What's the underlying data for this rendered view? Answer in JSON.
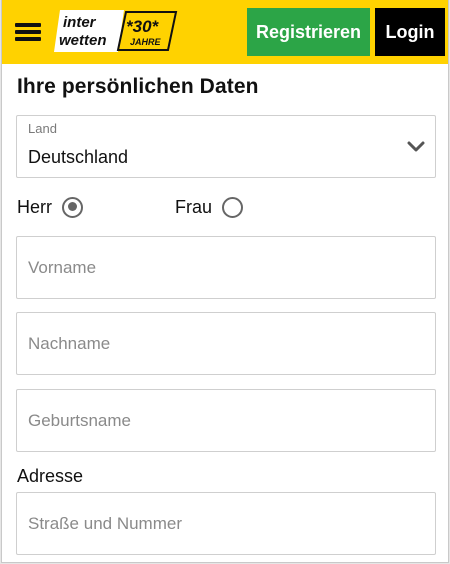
{
  "header": {
    "logo_line1": "inter",
    "logo_line2": "wetten",
    "logo_badge": "*30*",
    "logo_badge_sub": "JAHRE",
    "register_label": "Registrieren",
    "login_label": "Login",
    "colors": {
      "bar": "#ffd200",
      "register": "#2ca547",
      "login": "#000000"
    }
  },
  "form": {
    "title": "Ihre persönlichen Daten",
    "country": {
      "label": "Land",
      "value": "Deutschland"
    },
    "salutation": [
      {
        "label": "Herr",
        "selected": true
      },
      {
        "label": "Frau",
        "selected": false
      }
    ],
    "first_name": {
      "placeholder": "Vorname"
    },
    "last_name": {
      "placeholder": "Nachname"
    },
    "birth_name": {
      "placeholder": "Geburtsname"
    },
    "address_label": "Adresse",
    "street": {
      "placeholder": "Straße und Nummer"
    }
  }
}
